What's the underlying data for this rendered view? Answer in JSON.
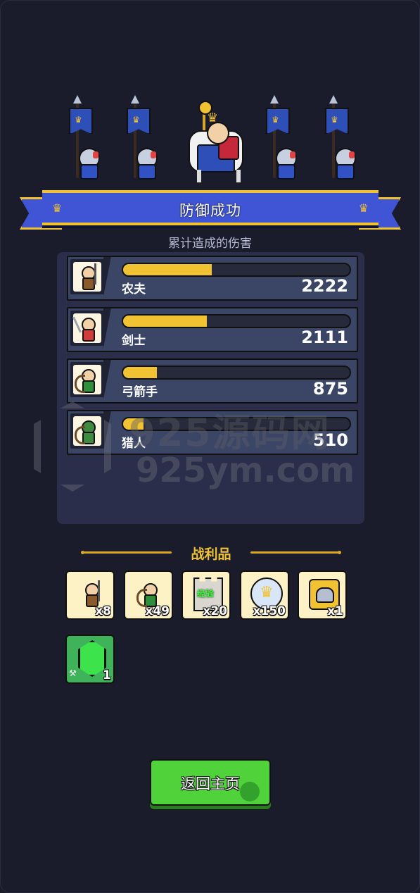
{
  "title": "防御成功",
  "subtitle": "累计造成的伤害",
  "damage": [
    {
      "name": "农夫",
      "value": "2222",
      "fraction": 0.39,
      "icon": "farmer-icon"
    },
    {
      "name": "剑士",
      "value": "2111",
      "fraction": 0.37,
      "icon": "swordsman-icon"
    },
    {
      "name": "弓箭手",
      "value": "875",
      "fraction": 0.15,
      "icon": "archer-icon"
    },
    {
      "name": "猎人",
      "value": "510",
      "fraction": 0.09,
      "icon": "hunter-icon"
    }
  ],
  "loot": {
    "title": "战利品",
    "items": [
      {
        "icon": "farmer-icon",
        "count": "x8"
      },
      {
        "icon": "archer-icon",
        "count": "x49"
      },
      {
        "icon": "experience-tower-icon",
        "label": "经验",
        "count": "x20"
      },
      {
        "icon": "crown-coin-icon",
        "count": "x150"
      },
      {
        "icon": "helmet-card-icon",
        "count": "x1"
      },
      {
        "icon": "emerald-gem-icon",
        "count": "1"
      }
    ]
  },
  "return_button": {
    "label": "返回主页"
  },
  "watermark": {
    "top": "925源码网",
    "bottom": "925ym.com"
  },
  "colors": {
    "background": "#1a1c2b",
    "ribbon": "#3f55d6",
    "gold": "#f1c232",
    "button": "#4fd23a",
    "row": "#3b4666"
  }
}
